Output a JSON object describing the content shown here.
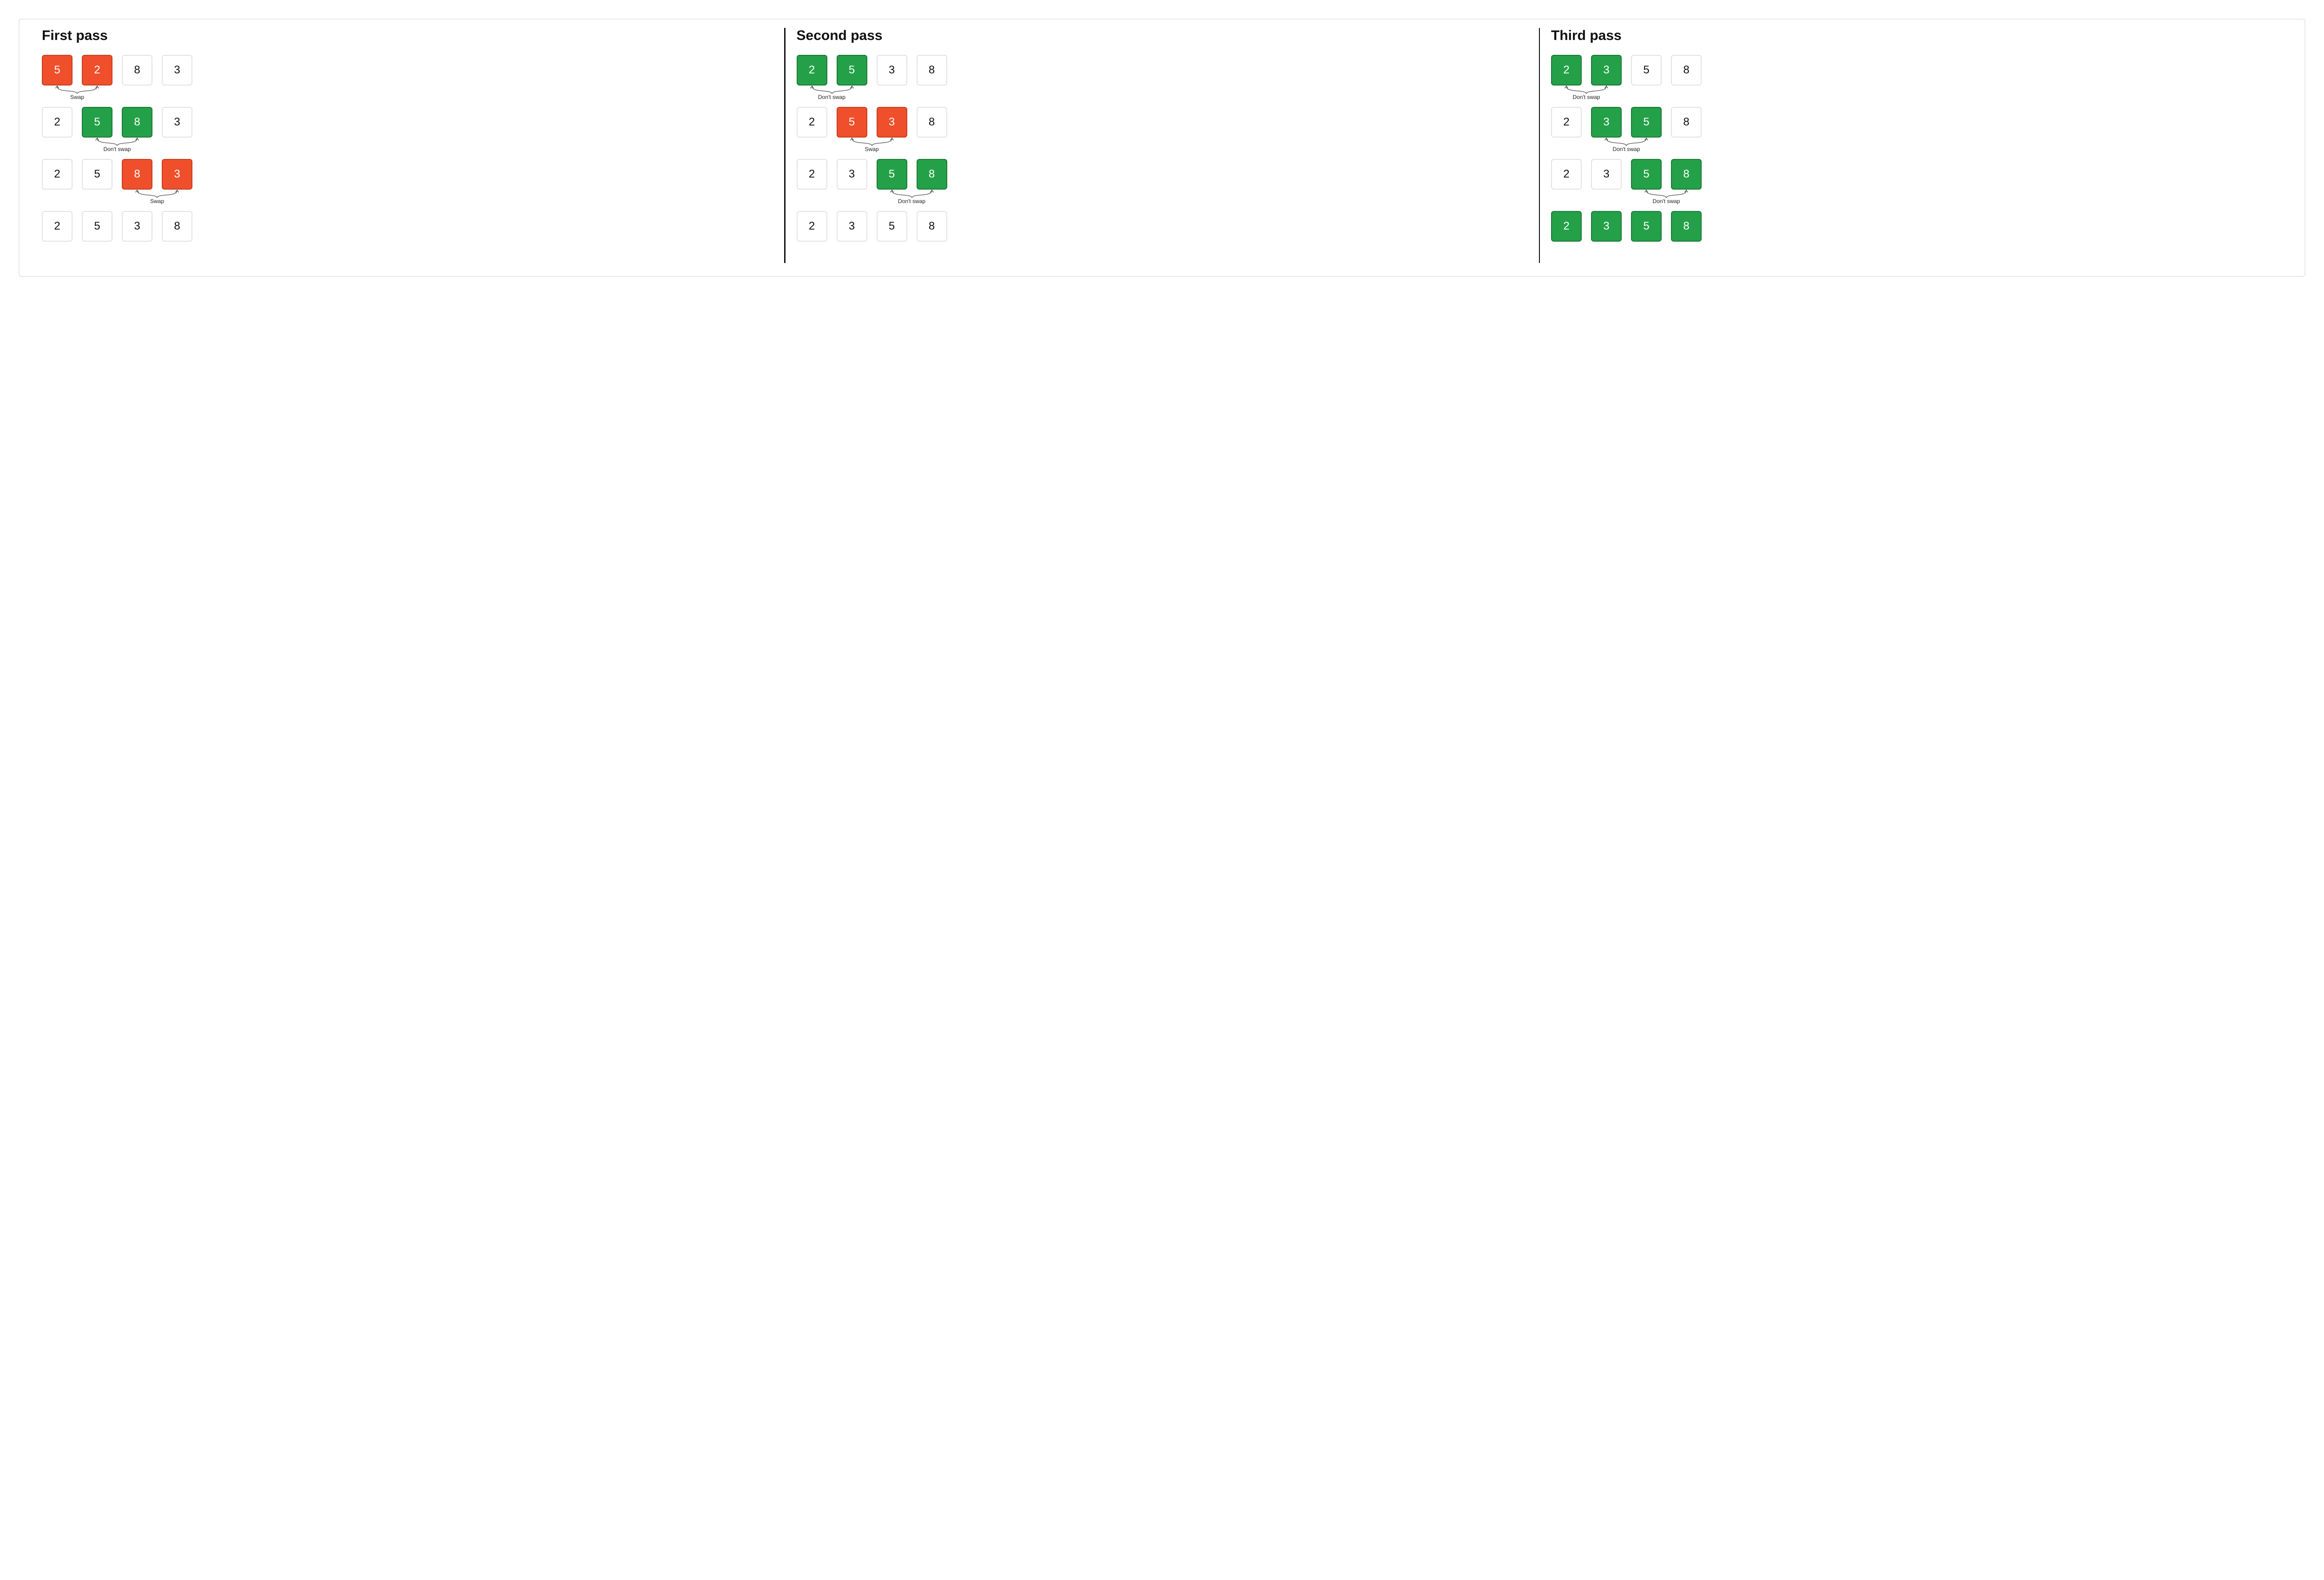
{
  "labels": {
    "swap": "Swap",
    "noswap": "Don't swap"
  },
  "passes": [
    {
      "title": "First pass",
      "steps": [
        {
          "cells": [
            {
              "v": "5",
              "s": "swap"
            },
            {
              "v": "2",
              "s": "swap"
            },
            {
              "v": "8",
              "s": "plain"
            },
            {
              "v": "3",
              "s": "plain"
            }
          ],
          "annot": {
            "hi": [
              0,
              1
            ],
            "kind": "swap"
          }
        },
        {
          "cells": [
            {
              "v": "2",
              "s": "plain"
            },
            {
              "v": "5",
              "s": "noswap"
            },
            {
              "v": "8",
              "s": "noswap"
            },
            {
              "v": "3",
              "s": "plain"
            }
          ],
          "annot": {
            "hi": [
              1,
              2
            ],
            "kind": "noswap"
          }
        },
        {
          "cells": [
            {
              "v": "2",
              "s": "plain"
            },
            {
              "v": "5",
              "s": "plain"
            },
            {
              "v": "8",
              "s": "swap"
            },
            {
              "v": "3",
              "s": "swap"
            }
          ],
          "annot": {
            "hi": [
              2,
              3
            ],
            "kind": "swap"
          }
        },
        {
          "cells": [
            {
              "v": "2",
              "s": "plain"
            },
            {
              "v": "5",
              "s": "plain"
            },
            {
              "v": "3",
              "s": "plain"
            },
            {
              "v": "8",
              "s": "plain"
            }
          ],
          "annot": null
        }
      ]
    },
    {
      "title": "Second pass",
      "steps": [
        {
          "cells": [
            {
              "v": "2",
              "s": "noswap"
            },
            {
              "v": "5",
              "s": "noswap"
            },
            {
              "v": "3",
              "s": "plain"
            },
            {
              "v": "8",
              "s": "plain"
            }
          ],
          "annot": {
            "hi": [
              0,
              1
            ],
            "kind": "noswap"
          }
        },
        {
          "cells": [
            {
              "v": "2",
              "s": "plain"
            },
            {
              "v": "5",
              "s": "swap"
            },
            {
              "v": "3",
              "s": "swap"
            },
            {
              "v": "8",
              "s": "plain"
            }
          ],
          "annot": {
            "hi": [
              1,
              2
            ],
            "kind": "swap"
          }
        },
        {
          "cells": [
            {
              "v": "2",
              "s": "plain"
            },
            {
              "v": "3",
              "s": "plain"
            },
            {
              "v": "5",
              "s": "noswap"
            },
            {
              "v": "8",
              "s": "noswap"
            }
          ],
          "annot": {
            "hi": [
              2,
              3
            ],
            "kind": "noswap"
          }
        },
        {
          "cells": [
            {
              "v": "2",
              "s": "plain"
            },
            {
              "v": "3",
              "s": "plain"
            },
            {
              "v": "5",
              "s": "plain"
            },
            {
              "v": "8",
              "s": "plain"
            }
          ],
          "annot": null
        }
      ]
    },
    {
      "title": "Third pass",
      "steps": [
        {
          "cells": [
            {
              "v": "2",
              "s": "noswap"
            },
            {
              "v": "3",
              "s": "noswap"
            },
            {
              "v": "5",
              "s": "plain"
            },
            {
              "v": "8",
              "s": "plain"
            }
          ],
          "annot": {
            "hi": [
              0,
              1
            ],
            "kind": "noswap"
          }
        },
        {
          "cells": [
            {
              "v": "2",
              "s": "plain"
            },
            {
              "v": "3",
              "s": "noswap"
            },
            {
              "v": "5",
              "s": "noswap"
            },
            {
              "v": "8",
              "s": "plain"
            }
          ],
          "annot": {
            "hi": [
              1,
              2
            ],
            "kind": "noswap"
          }
        },
        {
          "cells": [
            {
              "v": "2",
              "s": "plain"
            },
            {
              "v": "3",
              "s": "plain"
            },
            {
              "v": "5",
              "s": "noswap"
            },
            {
              "v": "8",
              "s": "noswap"
            }
          ],
          "annot": {
            "hi": [
              2,
              3
            ],
            "kind": "noswap"
          }
        },
        {
          "cells": [
            {
              "v": "2",
              "s": "sorted"
            },
            {
              "v": "3",
              "s": "sorted"
            },
            {
              "v": "5",
              "s": "sorted"
            },
            {
              "v": "8",
              "s": "sorted"
            }
          ],
          "annot": null
        }
      ]
    }
  ]
}
